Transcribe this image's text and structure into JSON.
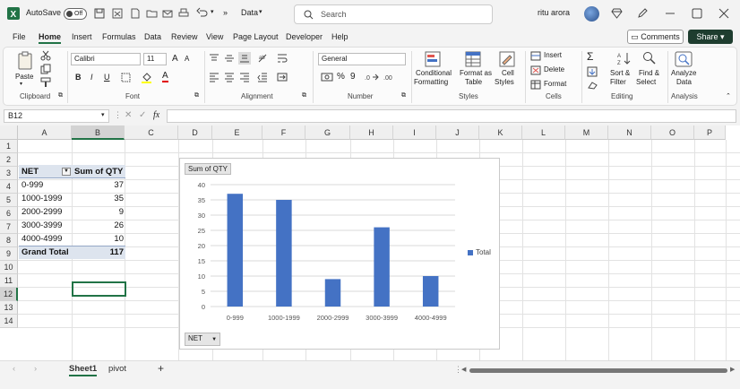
{
  "titlebar": {
    "autosave_label": "AutoSave",
    "autosave_state": "Off",
    "document_name": "Data",
    "more": "»",
    "search_placeholder": "Search",
    "user_name": "ritu arora"
  },
  "menu": [
    "File",
    "Home",
    "Insert",
    "Formulas",
    "Data",
    "Review",
    "View",
    "Page Layout",
    "Developer",
    "Help"
  ],
  "menu_active": "Home",
  "buttons": {
    "comments": "Comments",
    "share": "Share"
  },
  "ribbon": {
    "clipboard": {
      "label": "Clipboard",
      "paste": "Paste"
    },
    "font": {
      "label": "Font",
      "name": "Calibri",
      "size": "11",
      "grow": "A",
      "shrink": "A",
      "bold": "B",
      "italic": "I",
      "underline": "U",
      "color": "A"
    },
    "alignment": {
      "label": "Alignment"
    },
    "number": {
      "label": "Number",
      "format": "General",
      "percent": "%",
      "comma": "9"
    },
    "styles": {
      "label": "Styles",
      "conditional1": "Conditional",
      "conditional2": "Formatting",
      "format_table1": "Format as",
      "format_table2": "Table",
      "cell_styles1": "Cell",
      "cell_styles2": "Styles"
    },
    "cells": {
      "label": "Cells",
      "insert": "Insert",
      "delete": "Delete",
      "format": "Format"
    },
    "editing": {
      "label": "Editing",
      "sum": "Σ",
      "sort1": "Sort &",
      "sort2": "Filter",
      "find1": "Find &",
      "find2": "Select"
    },
    "analysis": {
      "label": "Analysis",
      "analyze1": "Analyze",
      "analyze2": "Data"
    }
  },
  "formula_bar": {
    "name_box": "B12",
    "fx": "fx",
    "value": ""
  },
  "grid": {
    "columns": [
      "A",
      "B",
      "C",
      "D",
      "E",
      "F",
      "G",
      "H",
      "I",
      "J",
      "K",
      "L",
      "M",
      "N",
      "O",
      "P"
    ],
    "rows": [
      "1",
      "2",
      "3",
      "4",
      "5",
      "6",
      "7",
      "8",
      "9",
      "10",
      "11",
      "12",
      "13",
      "14"
    ],
    "selected_col": "B",
    "selected_row": "12"
  },
  "pivot": {
    "header_label": "NET",
    "header_value": "Sum of QTY",
    "rows": [
      {
        "label": "0-999",
        "value": "37"
      },
      {
        "label": "1000-1999",
        "value": "35"
      },
      {
        "label": "2000-2999",
        "value": "9"
      },
      {
        "label": "3000-3999",
        "value": "26"
      },
      {
        "label": "4000-4999",
        "value": "10"
      }
    ],
    "total_label": "Grand Total",
    "total_value": "117"
  },
  "chart_data": {
    "type": "bar",
    "field_button_top": "Sum of QTY",
    "field_button_bottom": "NET",
    "categories": [
      "0-999",
      "1000-1999",
      "2000-2999",
      "3000-3999",
      "4000-4999"
    ],
    "series": [
      {
        "name": "Total",
        "values": [
          37,
          35,
          9,
          26,
          10
        ],
        "color": "#4472c4"
      }
    ],
    "ylim": [
      0,
      40
    ],
    "yticks": [
      "0",
      "5",
      "10",
      "15",
      "20",
      "25",
      "30",
      "35",
      "40"
    ],
    "grid": true,
    "legend": "right"
  },
  "sheets": {
    "tabs": [
      "Sheet1",
      "pivot"
    ],
    "active": "Sheet1",
    "add": "+"
  },
  "colors": {
    "accent": "#217346",
    "share_bg": "#1e3d2f",
    "bar": "#4472c4"
  }
}
